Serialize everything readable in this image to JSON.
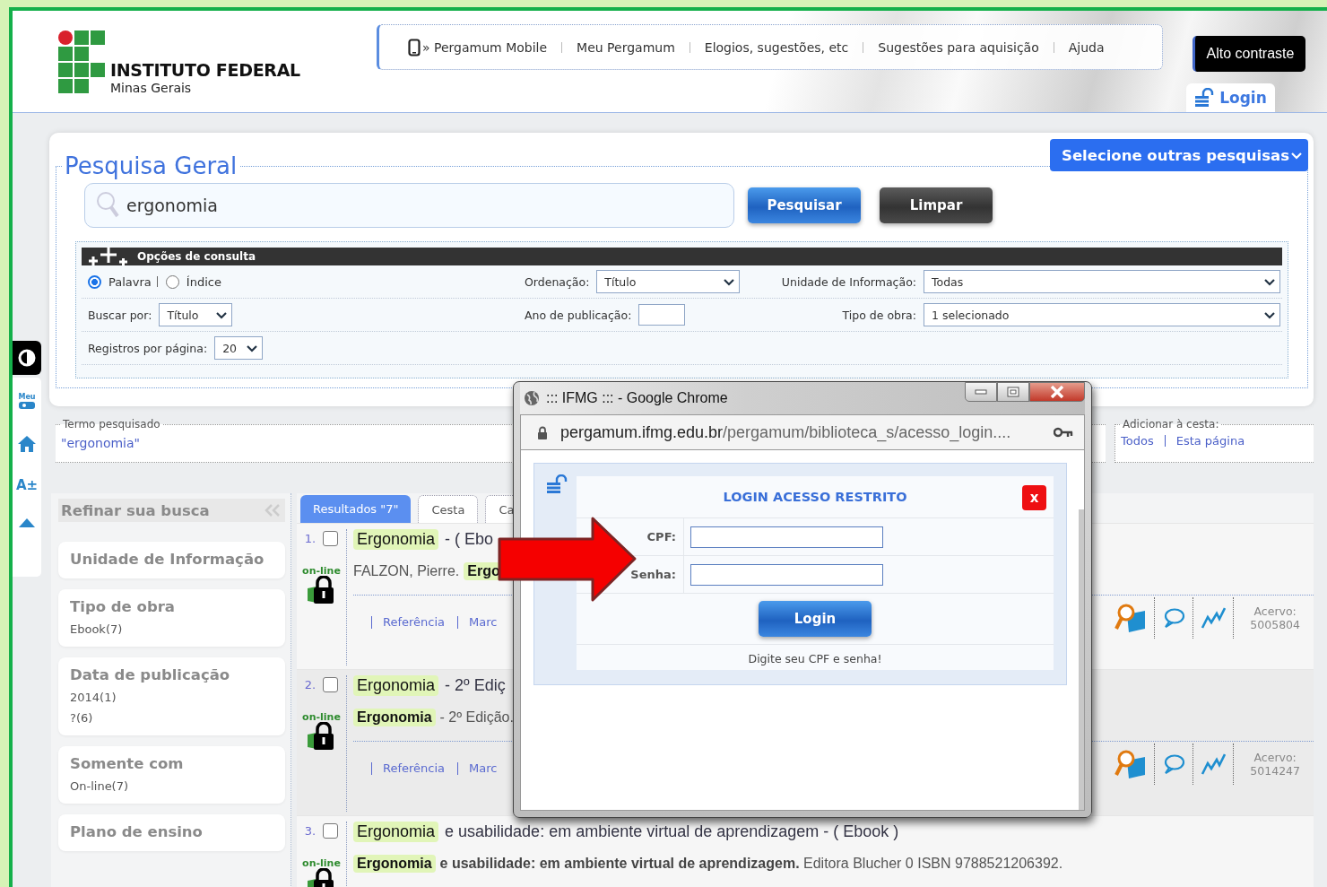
{
  "header": {
    "logo": {
      "name": "INSTITUTO FEDERAL",
      "subtitle": "Minas Gerais"
    },
    "nav_links": [
      "» Pergamum Mobile",
      "Meu Pergamum",
      "Elogios, sugestões, etc",
      "Sugestões para aquisição",
      "Ajuda"
    ],
    "contrast_button": "Alto contraste",
    "login_link": "Login"
  },
  "side_tools": [
    {
      "kind": "contrast"
    },
    {
      "kind": "meu",
      "label": "Meu"
    },
    {
      "kind": "home"
    },
    {
      "kind": "font",
      "label": "A±"
    },
    {
      "kind": "top"
    }
  ],
  "search": {
    "title": "Pesquisa Geral",
    "other_searches": "Selecione outras pesquisas",
    "query": "ergonomia",
    "buttons": [
      "Pesquisar",
      "Limpar"
    ]
  },
  "options": {
    "title": "Opções de consulta",
    "modes": [
      {
        "label": "Palavra",
        "selected": true
      },
      {
        "label": "Índice",
        "selected": false
      }
    ],
    "ordering": {
      "label": "Ordenação:",
      "value": "Título"
    },
    "unit": {
      "label": "Unidade de Informação:",
      "value": "Todas"
    },
    "search_by": {
      "label": "Buscar por:",
      "value": "Título"
    },
    "year": {
      "label": "Ano de publicação:"
    },
    "work_type": {
      "label": "Tipo de obra:",
      "value": "1 selecionado"
    },
    "per_page": {
      "label": "Registros por página:",
      "value": "20"
    }
  },
  "term": {
    "legend": "Termo pesquisado",
    "value": "\"ergonomia\""
  },
  "basket": {
    "legend": "Adicionar à cesta:",
    "links": [
      "Todos",
      "Esta página"
    ]
  },
  "refine": {
    "title": "Refinar sua busca",
    "groups": [
      {
        "title": "Unidade de Informação"
      },
      {
        "title": "Tipo de obra",
        "options": [
          "Ebook(7)"
        ]
      },
      {
        "title": "Data de publicação",
        "options": [
          "2014(1)",
          "?(6)"
        ]
      },
      {
        "title": "Somente com",
        "options": [
          "On-line(7)"
        ]
      },
      {
        "title": "Plano de ensino"
      }
    ]
  },
  "tabs": [
    {
      "label": "Resultados \"7\"",
      "selected": true
    },
    {
      "label": "Cesta",
      "selected": false
    },
    {
      "label": "Ca",
      "selected": false
    }
  ],
  "results": [
    {
      "number": "1.",
      "checked": false,
      "title": [
        {
          "kind": "highlight",
          "text": "Ergonomia"
        },
        {
          "kind": "plain",
          "text": "- ( Ebo"
        }
      ],
      "status": "on-line",
      "detail": [
        {
          "kind": "plain",
          "text": "FALZON, Pierre."
        },
        {
          "kind": "highlight",
          "text": "Ergo"
        }
      ],
      "links": [
        "Referência",
        "Marc"
      ],
      "acervo_label": "Acervo:",
      "acervo": "5005804"
    },
    {
      "number": "2.",
      "checked": false,
      "title": [
        {
          "kind": "highlight",
          "text": "Ergonomia"
        },
        {
          "kind": "plain",
          "text": "- 2º Ediç"
        }
      ],
      "status": "on-line",
      "detail": [
        {
          "kind": "highlight",
          "text": "Ergonomia"
        },
        {
          "kind": "plain",
          "text": "- 2º Edição."
        }
      ],
      "links": [
        "Referência",
        "Marc"
      ],
      "acervo_label": "Acervo:",
      "acervo": "5014247"
    },
    {
      "number": "3.",
      "checked": false,
      "title": [
        {
          "kind": "highlight",
          "text": "Ergonomia"
        },
        {
          "kind": "plain",
          "text": "e usabilidade: em ambiente virtual de aprendizagem - ( Ebook )"
        }
      ],
      "status": "on-line",
      "detail": [
        {
          "kind": "highlight",
          "text": "Ergonomia"
        },
        {
          "kind": "plain",
          "text": "**e usabilidade: em ambiente virtual de aprendizagem.** Editora Blucher 0 ISBN 9788521206392."
        }
      ]
    }
  ],
  "popup": {
    "title": "::: IFMG ::: - Google Chrome",
    "url_host": "pergamum.ifmg.edu.br",
    "url_path": "/pergamum/biblioteca_s/acesso_login....",
    "login": {
      "title": "LOGIN ACESSO RESTRITO",
      "close": "x",
      "fields": [
        {
          "label": "CPF:"
        },
        {
          "label": "Senha:"
        }
      ],
      "button": "Login",
      "hint": "Digite seu CPF e senha!"
    }
  }
}
